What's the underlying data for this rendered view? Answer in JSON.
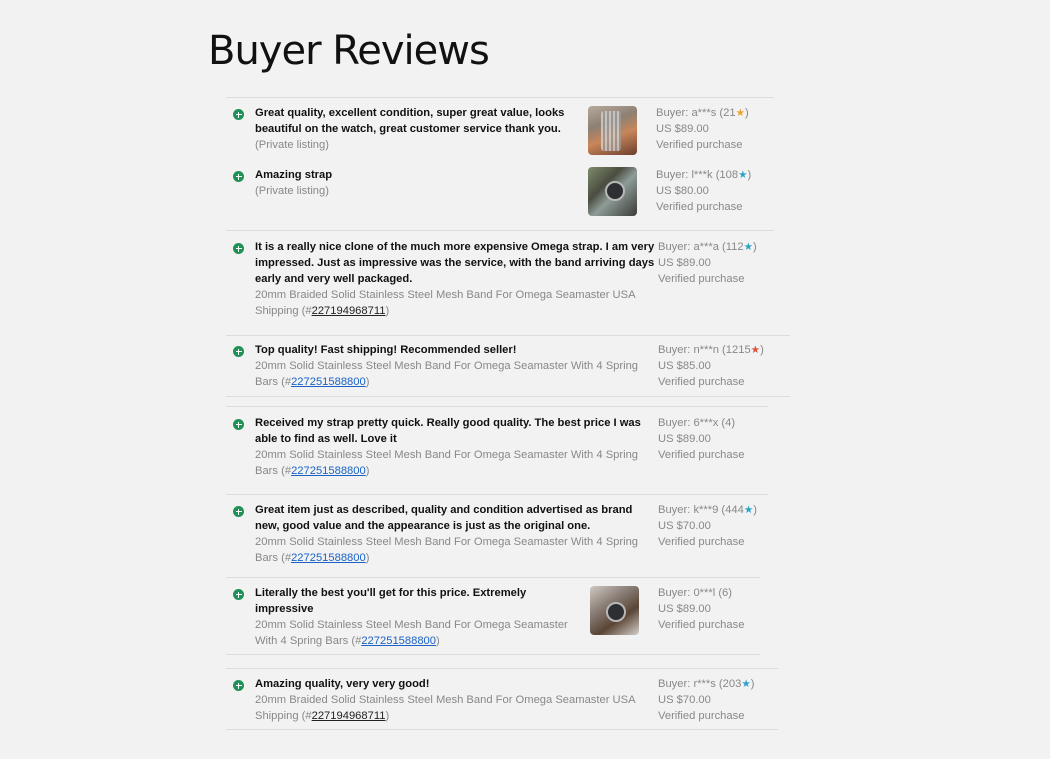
{
  "title": "Buyer Reviews",
  "colors": {
    "plus": "#1f9157",
    "link": "#1a62c7",
    "star_orange": "#f0a127",
    "star_teal": "#2aa3c9",
    "star_red": "#e0503c"
  },
  "reviews": [
    {
      "comment": [
        "Great quality, excellent condition, super great value, looks",
        "beautiful on the watch, great customer service thank you."
      ],
      "item": [
        "(Private listing)"
      ],
      "buyer": "Buyer: a***s (21",
      "star": "★",
      "star_color": "#f0a127",
      "close": ")",
      "price": "US $89.00",
      "verified": "Verified purchase",
      "photo": "watch-mesh-band-photo"
    },
    {
      "comment": [
        "Amazing strap"
      ],
      "item": [
        "(Private listing)"
      ],
      "buyer": "Buyer: l***k (108",
      "star": "★",
      "star_color": "#2aa3c9",
      "close": ")",
      "price": "US $80.00",
      "verified": "Verified purchase",
      "photo": "watch-on-wrist-photo"
    },
    {
      "comment": [
        "It is a really nice clone of the much more expensive Omega strap. I am very",
        "impressed. Just as impressive was the service, with the band arriving days",
        "early and very well packaged."
      ],
      "item": [
        "20mm Braided Solid Stainless Steel Mesh Band For Omega Seamaster USA"
      ],
      "item_last_prefix": "Shipping (#",
      "item_id": "227194968711",
      "item_suffix": ")",
      "buyer": "Buyer: a***a (112",
      "star": "★",
      "star_color": "#2aa3c9",
      "close": ")",
      "price": "US $89.00",
      "verified": "Verified purchase"
    },
    {
      "comment": [
        "Top quality! Fast shipping! Recommended seller!"
      ],
      "item": [
        "20mm Solid Stainless Steel Mesh Band For Omega Seamaster With 4 Spring"
      ],
      "item_last_prefix": "Bars (#",
      "item_id": "227251588800",
      "item_suffix": ")",
      "buyer": "Buyer: n***n (1215",
      "star": "★",
      "star_color": "#e0503c",
      "close": ")",
      "price": "US $85.00",
      "verified": "Verified purchase"
    },
    {
      "comment": [
        "Received my strap pretty quick. Really good quality. The best price I was",
        "able to find as well. Love it"
      ],
      "item": [
        "20mm Solid Stainless Steel Mesh Band For Omega Seamaster With 4 Spring"
      ],
      "item_last_prefix": "Bars (#",
      "item_id": "227251588800",
      "item_suffix": ")",
      "buyer": "Buyer: 6***x (4)",
      "price": "US $89.00",
      "verified": "Verified purchase"
    },
    {
      "comment": [
        "Great item just as described, quality and condition advertised as brand",
        "new, good value and the appearance is just as the original one."
      ],
      "item": [
        "20mm Solid Stainless Steel Mesh Band For Omega Seamaster With 4 Spring"
      ],
      "item_last_prefix": "Bars (#",
      "item_id": "227251588800",
      "item_suffix": ")",
      "buyer": "Buyer: k***9 (444",
      "star": "★",
      "star_color": "#2aa3c9",
      "close": ")",
      "price": "US $70.00",
      "verified": "Verified purchase"
    },
    {
      "comment": [
        "Literally the best you'll get for this price. Extremely",
        "impressive"
      ],
      "item": [
        "20mm Solid Stainless Steel Mesh Band For Omega Seamaster"
      ],
      "item_last_prefix": "With 4 Spring Bars (#",
      "item_id": "227251588800",
      "item_suffix": ")",
      "buyer": "Buyer: 0***l (6)",
      "price": "US $89.00",
      "verified": "Verified purchase",
      "photo": "watch-closeup-photo"
    },
    {
      "comment": [
        "Amazing quality, very very good!"
      ],
      "item": [
        "20mm Braided Solid Stainless Steel Mesh Band For Omega Seamaster USA"
      ],
      "item_last_prefix": "Shipping (#",
      "item_id": "227194968711",
      "item_suffix": ")",
      "buyer": "Buyer: r***s (203",
      "star": "★",
      "star_color": "#2aa3c9",
      "close": ")",
      "price": "US $70.00",
      "verified": "Verified purchase"
    }
  ]
}
